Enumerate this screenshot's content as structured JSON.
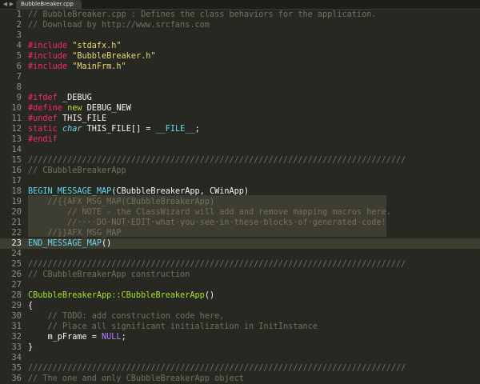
{
  "tab": {
    "title": "BubbleBreaker.cpp",
    "nav_left": "◀",
    "nav_right": "▶"
  },
  "active_line": 23,
  "lines": [
    {
      "n": "1",
      "t": [
        [
          "c",
          "// BubbleBreaker.cpp : Defines the class behaviors for the application."
        ]
      ]
    },
    {
      "n": "2",
      "t": [
        [
          "c",
          "// Download by http://www.srcfans.com"
        ]
      ]
    },
    {
      "n": "3",
      "t": []
    },
    {
      "n": "4",
      "t": [
        [
          "p",
          "#include"
        ],
        [
          "x",
          " "
        ],
        [
          "s",
          "\"stdafx.h\""
        ]
      ]
    },
    {
      "n": "5",
      "t": [
        [
          "p",
          "#include"
        ],
        [
          "x",
          " "
        ],
        [
          "s",
          "\"BubbleBreaker.h\""
        ]
      ]
    },
    {
      "n": "6",
      "t": [
        [
          "p",
          "#include"
        ],
        [
          "x",
          " "
        ],
        [
          "s",
          "\"MainFrm.h\""
        ]
      ]
    },
    {
      "n": "7",
      "t": []
    },
    {
      "n": "8",
      "t": []
    },
    {
      "n": "9",
      "t": [
        [
          "p",
          "#ifdef"
        ],
        [
          "x",
          " _DEBUG"
        ]
      ]
    },
    {
      "n": "10",
      "t": [
        [
          "p",
          "#define"
        ],
        [
          "x",
          " "
        ],
        [
          "g",
          "new"
        ],
        [
          "x",
          " DEBUG_NEW"
        ]
      ]
    },
    {
      "n": "11",
      "t": [
        [
          "p",
          "#undef"
        ],
        [
          "x",
          " THIS_FILE"
        ]
      ]
    },
    {
      "n": "12",
      "t": [
        [
          "k",
          "static"
        ],
        [
          "x",
          " "
        ],
        [
          "y",
          "char"
        ],
        [
          "x",
          " THIS_FILE[] = "
        ],
        [
          "m",
          "__FILE__"
        ],
        [
          "x",
          ";"
        ]
      ]
    },
    {
      "n": "13",
      "t": [
        [
          "p",
          "#endif"
        ]
      ]
    },
    {
      "n": "14",
      "t": []
    },
    {
      "n": "15",
      "t": [
        [
          "c",
          "/////////////////////////////////////////////////////////////////////////////"
        ]
      ]
    },
    {
      "n": "16",
      "t": [
        [
          "c",
          "// CBubbleBreakerApp"
        ]
      ]
    },
    {
      "n": "17",
      "t": []
    },
    {
      "n": "18",
      "t": [
        [
          "m",
          "BEGIN_MESSAGE_MAP"
        ],
        [
          "x",
          "(CBubbleBreakerApp, CWinApp)"
        ]
      ]
    },
    {
      "n": "19",
      "t": [
        [
          "d",
          "    "
        ],
        [
          "c",
          "//{{AFX_MSG_MAP(CBubbleBreakerApp)"
        ]
      ]
    },
    {
      "n": "20",
      "t": [
        [
          "d",
          "        "
        ],
        [
          "c",
          "// NOTE - the ClassWizard will add and remove mapping macros here."
        ]
      ]
    },
    {
      "n": "21",
      "t": [
        [
          "d",
          "        "
        ],
        [
          "c",
          "//····DO·NOT·EDIT·what·you·see·in·these·blocks·of·generated·code!"
        ]
      ]
    },
    {
      "n": "22",
      "t": [
        [
          "d",
          "    "
        ],
        [
          "c",
          "//}}AFX_MSG_MAP"
        ]
      ]
    },
    {
      "n": "23",
      "t": [
        [
          "m",
          "END_MESSAGE_MAP"
        ],
        [
          "x",
          "()"
        ]
      ]
    },
    {
      "n": "24",
      "t": []
    },
    {
      "n": "25",
      "t": [
        [
          "c",
          "/////////////////////////////////////////////////////////////////////////////"
        ]
      ]
    },
    {
      "n": "26",
      "t": [
        [
          "c",
          "// CBubbleBreakerApp construction"
        ]
      ]
    },
    {
      "n": "27",
      "t": []
    },
    {
      "n": "28",
      "t": [
        [
          "g",
          "CBubbleBreakerApp::CBubbleBreakerApp"
        ],
        [
          "x",
          "()"
        ]
      ]
    },
    {
      "n": "29",
      "t": [
        [
          "x",
          "{"
        ]
      ]
    },
    {
      "n": "30",
      "t": [
        [
          "x",
          "    "
        ],
        [
          "c",
          "// TODO: add construction code here,"
        ]
      ]
    },
    {
      "n": "31",
      "t": [
        [
          "x",
          "    "
        ],
        [
          "c",
          "// Place all significant initialization in InitInstance"
        ]
      ]
    },
    {
      "n": "32",
      "t": [
        [
          "x",
          "    m_pFrame = "
        ],
        [
          "n",
          "NULL"
        ],
        [
          "x",
          ";"
        ]
      ]
    },
    {
      "n": "33",
      "t": [
        [
          "x",
          "}"
        ]
      ]
    },
    {
      "n": "34",
      "t": []
    },
    {
      "n": "35",
      "t": [
        [
          "c",
          "/////////////////////////////////////////////////////////////////////////////"
        ]
      ]
    },
    {
      "n": "36",
      "t": [
        [
          "c",
          "// The one and only CBubbleBreakerApp object"
        ]
      ]
    }
  ],
  "colors": {
    "background": "#272822",
    "comment": "#75715e",
    "keyword": "#f92672",
    "string": "#e6db74",
    "type": "#66d9ef",
    "function": "#a6e22e",
    "number": "#ae81ff"
  }
}
